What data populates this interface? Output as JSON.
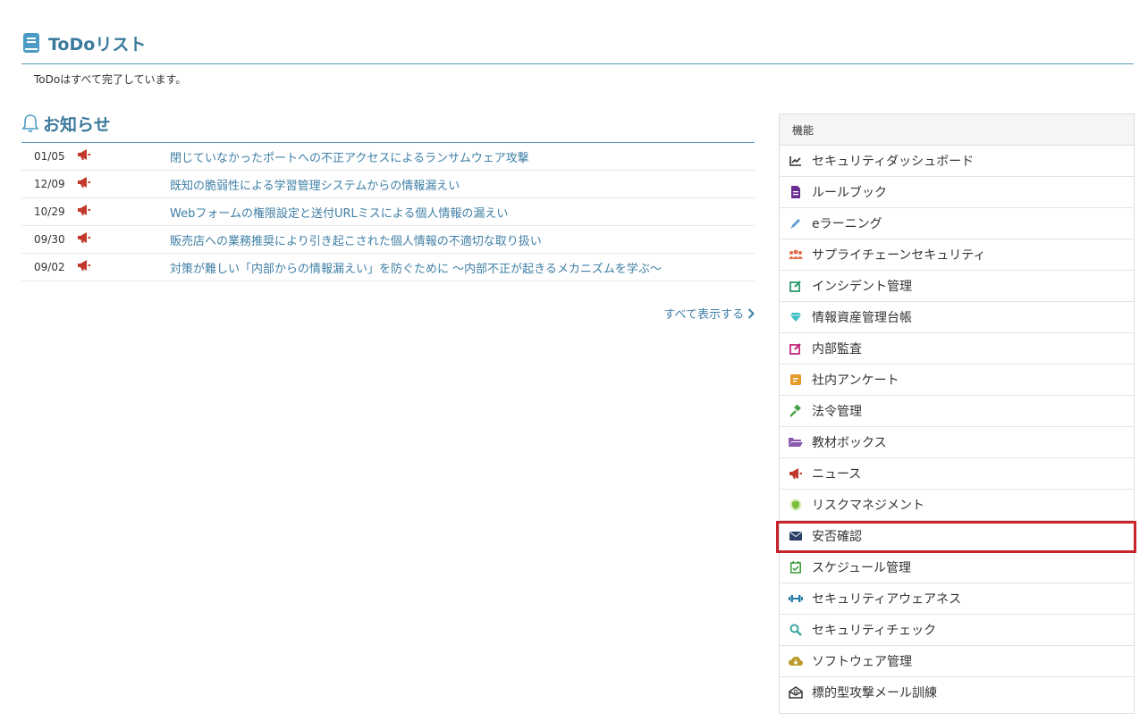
{
  "todo": {
    "title": "ToDoリスト",
    "message": "ToDoはすべて完了しています。"
  },
  "news": {
    "title": "お知らせ",
    "items": [
      {
        "date": "01/05",
        "text": "閉じていなかったポートへの不正アクセスによるランサムウェア攻撃"
      },
      {
        "date": "12/09",
        "text": "既知の脆弱性による学習管理システムからの情報漏えい"
      },
      {
        "date": "10/29",
        "text": "Webフォームの権限設定と送付URLミスによる個人情報の漏えい"
      },
      {
        "date": "09/30",
        "text": "販売店への業務推奨により引き起こされた個人情報の不適切な取り扱い"
      },
      {
        "date": "09/02",
        "text": "対策が難しい「内部からの情報漏えい」を防ぐために ～内部不正が起きるメカニズムを学ぶ～"
      }
    ],
    "show_all": "すべて表示する"
  },
  "features": {
    "heading": "機能",
    "items": [
      {
        "label": "セキュリティダッシュボード",
        "icon": "chart-line-icon",
        "color": "#333333"
      },
      {
        "label": "ルールブック",
        "icon": "document-icon",
        "color": "#6a2c91"
      },
      {
        "label": "eラーニング",
        "icon": "pencil-icon",
        "color": "#5a9bd5"
      },
      {
        "label": "サプライチェーンセキュリティ",
        "icon": "users-icon",
        "color": "#e0704a"
      },
      {
        "label": "インシデント管理",
        "icon": "edit-icon",
        "color": "#2e9b6e"
      },
      {
        "label": "情報資産管理台帳",
        "icon": "diamond-icon",
        "color": "#3dbfc4"
      },
      {
        "label": "内部監査",
        "icon": "edit-icon",
        "color": "#c2277a"
      },
      {
        "label": "社内アンケート",
        "icon": "survey-icon",
        "color": "#e59a2a"
      },
      {
        "label": "法令管理",
        "icon": "gavel-icon",
        "color": "#4aa04a"
      },
      {
        "label": "教材ボックス",
        "icon": "folder-icon",
        "color": "#8a5ab0"
      },
      {
        "label": "ニュース",
        "icon": "megaphone-icon",
        "color": "#c0392b"
      },
      {
        "label": "リスクマネジメント",
        "icon": "shield-icon",
        "color": "#7dbd3c"
      },
      {
        "label": "安否確認",
        "icon": "envelope-icon",
        "color": "#2c3e66"
      },
      {
        "label": "スケジュール管理",
        "icon": "calendar-check-icon",
        "color": "#3a9a3a"
      },
      {
        "label": "セキュリティアウェアネス",
        "icon": "dumbbell-icon",
        "color": "#2a7fa8"
      },
      {
        "label": "セキュリティチェック",
        "icon": "search-icon",
        "color": "#3aa6a0"
      },
      {
        "label": "ソフトウェア管理",
        "icon": "cloud-download-icon",
        "color": "#b99a2a"
      },
      {
        "label": "標的型攻撃メール訓練",
        "icon": "mail-open-icon",
        "color": "#333333"
      }
    ]
  },
  "colors": {
    "accent": "#3a7a9c",
    "link": "#3f7fa6",
    "highlight": "#c6232a",
    "megaphone": "#c0392b"
  }
}
